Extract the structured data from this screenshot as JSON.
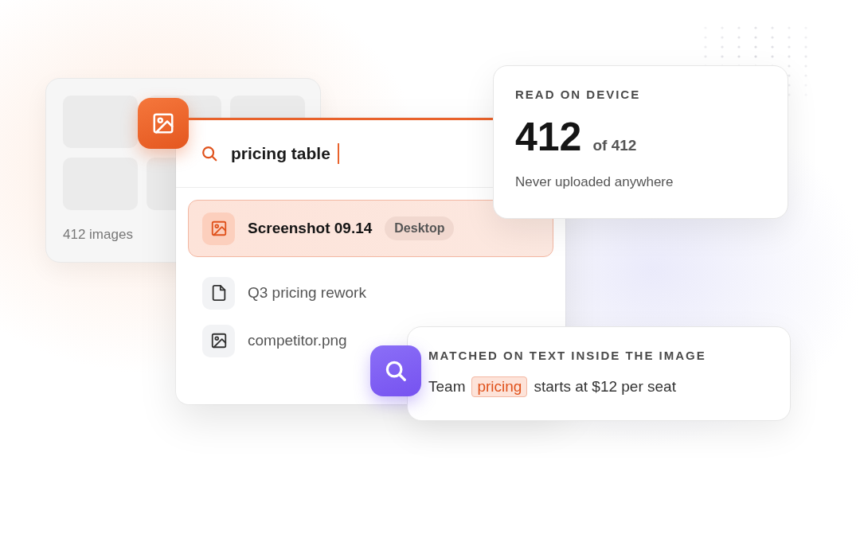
{
  "gallery": {
    "caption": "412 images"
  },
  "search": {
    "query": "pricing table"
  },
  "results": [
    {
      "kind": "image",
      "title": "Screenshot 09.14",
      "tag": "Desktop",
      "selected": true
    },
    {
      "kind": "document",
      "title": "Q3 pricing rework",
      "selected": false
    },
    {
      "kind": "image",
      "title": "competitor.png",
      "selected": false
    }
  ],
  "device_card": {
    "label": "READ ON DEVICE",
    "count": "412",
    "total": "of 412",
    "note": "Never uploaded anywhere"
  },
  "match_card": {
    "label": "MATCHED ON TEXT INSIDE THE IMAGE",
    "before": "Team",
    "highlight": "pricing",
    "after": "starts at $12 per seat"
  }
}
